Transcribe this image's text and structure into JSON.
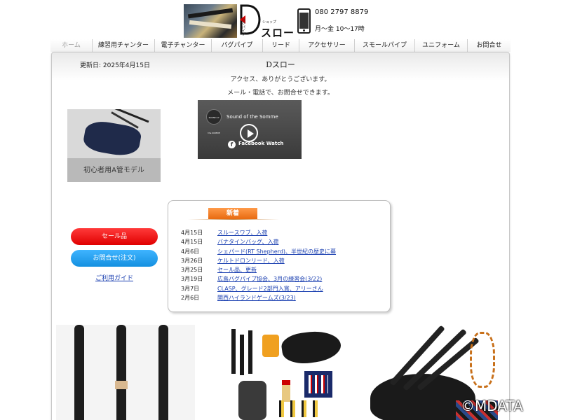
{
  "header": {
    "logo_small": "バグパイプ",
    "logo_shop": "ショップ",
    "logo_main": "スロー",
    "phone": "080 2797 8879",
    "hours": "月〜金 10〜17時"
  },
  "nav": {
    "items": [
      {
        "label": "ホーム",
        "width": 59
      },
      {
        "label": "練習用チャンター",
        "width": 89
      },
      {
        "label": "電子チャンター",
        "width": 81
      },
      {
        "label": "バグパイプ",
        "width": 73
      },
      {
        "label": "リード",
        "width": 52
      },
      {
        "label": "アクセサリー",
        "width": 79
      },
      {
        "label": "スモールパイプ",
        "width": 86
      },
      {
        "label": "ユニフォーム",
        "width": 75
      },
      {
        "label": "お問合せ",
        "width": 62
      }
    ]
  },
  "main": {
    "updated": "更新日: 2025年4月15日",
    "site_title": "Dスロー",
    "welcome1": "アクセス、ありがとうございます。",
    "welcome2": "メール・電話で、お問合せできます。"
  },
  "model_card": {
    "label": "初心者用A管モデル"
  },
  "video": {
    "avatar_text": "SOUND of the SOMME",
    "title": "Sound of the Somme",
    "fb_icon": "f",
    "fb_label": "Facebook Watch"
  },
  "buttons": {
    "sale": "セール品",
    "contact": "お問合せ(注文)",
    "guide": "ご利用ガイド"
  },
  "news": {
    "header": "新着",
    "items": [
      {
        "date": "4月15日",
        "text": "スルースワブ、入荷"
      },
      {
        "date": "4月15日",
        "text": "バナタインバッグ、入荷"
      },
      {
        "date": "4月6日",
        "text": "シェパード(RT Shepherd)、半世紀の歴史に幕"
      },
      {
        "date": "3月26日",
        "text": "ケルトドロンリード、入荷"
      },
      {
        "date": "3月25日",
        "text": "セール品、更新"
      },
      {
        "date": "3月19日",
        "text": "広島バグパイプ協会、3月の練習会(3/22)"
      },
      {
        "date": "3月7日",
        "text": "CLASP、グレード2部門入賞、アリーさん"
      },
      {
        "date": "2月6日",
        "text": "関西ハイランドゲームズ(3/23)"
      }
    ]
  },
  "footer": {
    "copyright": "©MDATA"
  }
}
